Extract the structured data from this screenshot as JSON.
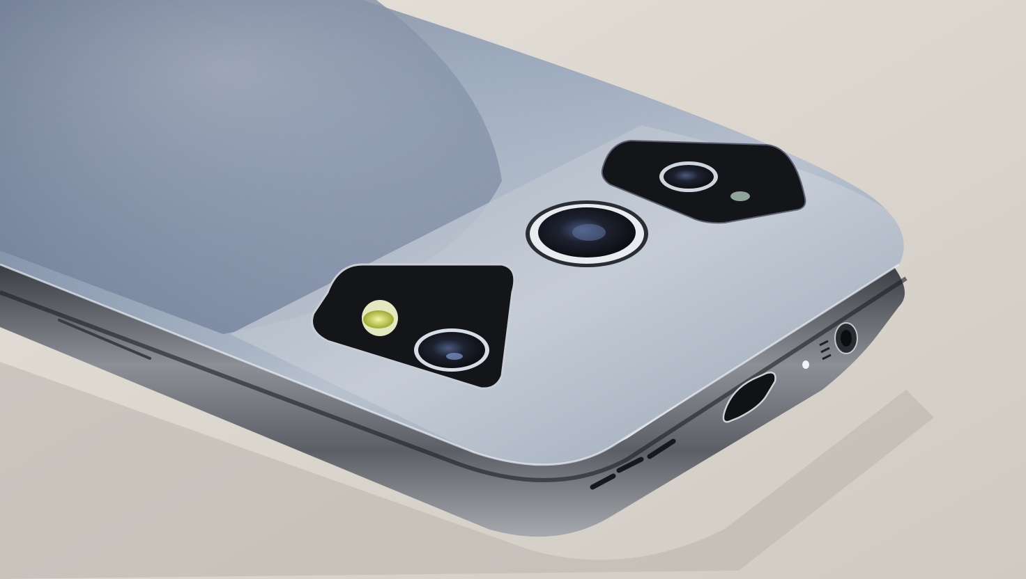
{
  "image": {
    "subject": "smartphone",
    "colors": {
      "background": "#dcd8cf",
      "body": "#7f8fa6",
      "frame": "#5a5f66",
      "lens": "#141519",
      "flash": "#d9e35a"
    },
    "icons": [
      "camera-lens-icon",
      "flash-icon",
      "usb-port-icon",
      "headphone-jack-icon",
      "speaker-grille-icon"
    ]
  }
}
